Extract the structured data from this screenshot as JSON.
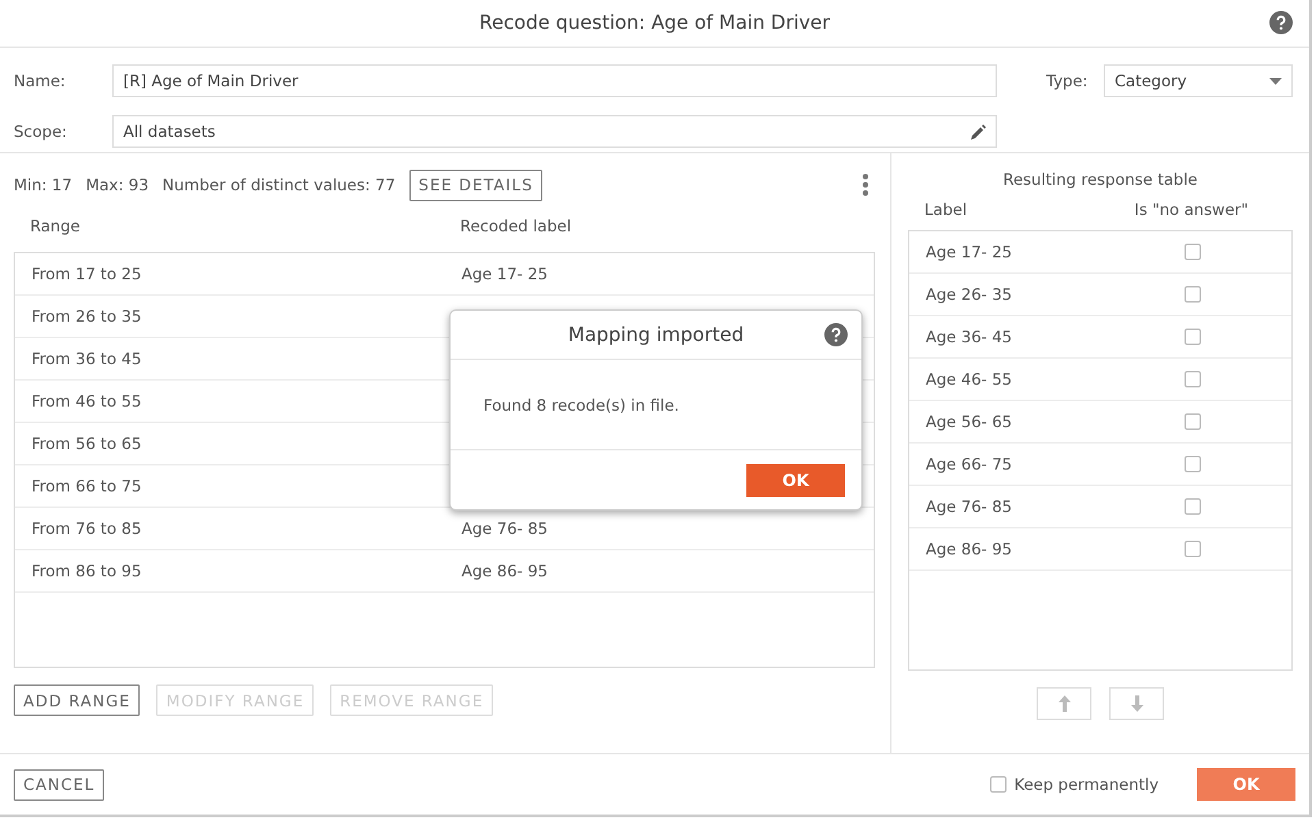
{
  "window": {
    "title": "Recode question: Age of Main Driver"
  },
  "form": {
    "name_label": "Name:",
    "name_value": "[R] Age of Main Driver",
    "scope_label": "Scope:",
    "scope_value": "All datasets",
    "type_label": "Type:",
    "type_value": "Category"
  },
  "stats": [
    {
      "label": "Min:",
      "value": "17"
    },
    {
      "label": "Max:",
      "value": "93"
    },
    {
      "label": "Number of distinct values:",
      "value": "77"
    }
  ],
  "see_details": "SEE DETAILS",
  "ranges": {
    "columns": [
      "Range",
      "Recoded label"
    ],
    "rows": [
      {
        "range": "From 17 to 25",
        "label": "Age 17- 25"
      },
      {
        "range": "From 26 to 35"
      },
      {
        "range": "From 36 to 45"
      },
      {
        "range": "From 46 to 55"
      },
      {
        "range": "From 56 to 65"
      },
      {
        "range": "From 66 to 75"
      },
      {
        "range": "From 76 to 85",
        "label": "Age 76- 85"
      },
      {
        "range": "From 86 to 95",
        "label": "Age 86- 95"
      }
    ]
  },
  "range_buttons": [
    {
      "label": "ADD RANGE",
      "disabled": false
    },
    {
      "label": "MODIFY RANGE",
      "disabled": true
    },
    {
      "label": "REMOVE RANGE",
      "disabled": true
    }
  ],
  "response_table": {
    "title": "Resulting response table",
    "columns": [
      "Label",
      "Is \"no answer\""
    ],
    "rows": [
      {
        "label": "Age 17- 25",
        "checked": false
      },
      {
        "label": "Age 26- 35",
        "checked": false
      },
      {
        "label": "Age 36- 45",
        "checked": false
      },
      {
        "label": "Age 46- 55",
        "checked": false
      },
      {
        "label": "Age 56- 65",
        "checked": false
      },
      {
        "label": "Age 66- 75",
        "checked": false
      },
      {
        "label": "Age 76- 85",
        "checked": false
      },
      {
        "label": "Age 86- 95",
        "checked": false
      }
    ],
    "move_buttons": [
      {
        "kind": "up",
        "disabled": true
      },
      {
        "kind": "down",
        "disabled": true
      }
    ]
  },
  "footer": {
    "cancel": "CANCEL",
    "keep_label": "Keep permanently",
    "keep_checked": false,
    "ok": "OK"
  },
  "popup": {
    "title": "Mapping imported",
    "message": "Found 8 recode(s) in file.",
    "ok": "OK"
  }
}
